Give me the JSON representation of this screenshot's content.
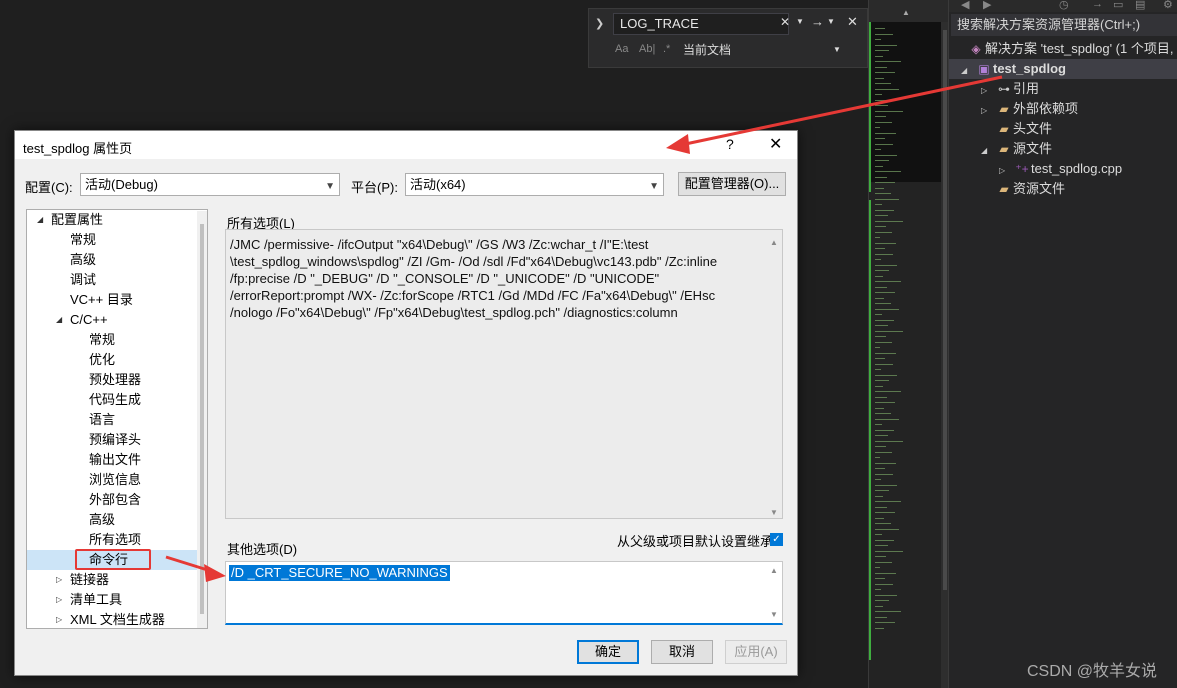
{
  "find_bar": {
    "query": "LOG_TRACE",
    "option_match_case": "Aa",
    "option_whole_word": "Ab|",
    "option_regex": ".*",
    "scope": "当前文档"
  },
  "solution_explorer": {
    "search_placeholder": "搜索解决方案资源管理器(Ctrl+;)",
    "items": [
      {
        "label": "解决方案 'test_spdlog' (1 个项目,",
        "icon": "solution-icon"
      },
      {
        "label": "test_spdlog",
        "icon": "project-icon"
      },
      {
        "label": "引用",
        "icon": "references-icon"
      },
      {
        "label": "外部依赖项",
        "icon": "folder-icon"
      },
      {
        "label": "头文件",
        "icon": "folder-icon"
      },
      {
        "label": "源文件",
        "icon": "folder-icon"
      },
      {
        "label": "test_spdlog.cpp",
        "icon": "cpp-file-icon"
      },
      {
        "label": "资源文件",
        "icon": "folder-icon"
      }
    ]
  },
  "watermark": "CSDN @牧羊女说",
  "dialog": {
    "title": "test_spdlog 属性页",
    "help": "?",
    "close": "✕",
    "config_label": "配置(C):",
    "config_value": "活动(Debug)",
    "platform_label": "平台(P):",
    "platform_value": "活动(x64)",
    "config_manager_button": "配置管理器(O)...",
    "tree": [
      {
        "label": "配置属性",
        "level": 0,
        "expanded": true
      },
      {
        "label": "常规",
        "level": 1
      },
      {
        "label": "高级",
        "level": 1
      },
      {
        "label": "调试",
        "level": 1
      },
      {
        "label": "VC++ 目录",
        "level": 1
      },
      {
        "label": "C/C++",
        "level": 1,
        "expanded": true
      },
      {
        "label": "常规",
        "level": 2
      },
      {
        "label": "优化",
        "level": 2
      },
      {
        "label": "预处理器",
        "level": 2
      },
      {
        "label": "代码生成",
        "level": 2
      },
      {
        "label": "语言",
        "level": 2
      },
      {
        "label": "预编译头",
        "level": 2
      },
      {
        "label": "输出文件",
        "level": 2
      },
      {
        "label": "浏览信息",
        "level": 2
      },
      {
        "label": "外部包含",
        "level": 2
      },
      {
        "label": "高级",
        "level": 2
      },
      {
        "label": "所有选项",
        "level": 2
      },
      {
        "label": "命令行",
        "level": 2,
        "selected": true
      },
      {
        "label": "链接器",
        "level": 1,
        "collapsed": true
      },
      {
        "label": "清单工具",
        "level": 1,
        "collapsed": true
      },
      {
        "label": "XML 文档生成器",
        "level": 1,
        "collapsed": true
      }
    ],
    "all_options_label": "所有选项(L)",
    "all_options_lines": [
      "/JMC /permissive- /ifcOutput \"x64\\Debug\\\" /GS /W3 /Zc:wchar_t /I\"E:\\test",
      "\\test_spdlog_windows\\spdlog\" /ZI /Gm- /Od /sdl /Fd\"x64\\Debug\\vc143.pdb\" /Zc:inline",
      "/fp:precise /D \"_DEBUG\" /D \"_CONSOLE\" /D \"_UNICODE\" /D \"UNICODE\"",
      "/errorReport:prompt /WX- /Zc:forScope /RTC1 /Gd /MDd /FC /Fa\"x64\\Debug\\\" /EHsc",
      "/nologo /Fo\"x64\\Debug\\\" /Fp\"x64\\Debug\\test_spdlog.pch\" /diagnostics:column"
    ],
    "other_options_label": "其他选项(D)",
    "inherit_label": "从父级或项目默认设置继承",
    "other_options_value": "/D _CRT_SECURE_NO_WARNINGS",
    "ok_button": "确定",
    "cancel_button": "取消",
    "apply_button": "应用(A)"
  },
  "colors": {
    "annotation_red": "#e53935",
    "selection_blue": "#0078d7",
    "ide_background": "#1f1f1f"
  }
}
